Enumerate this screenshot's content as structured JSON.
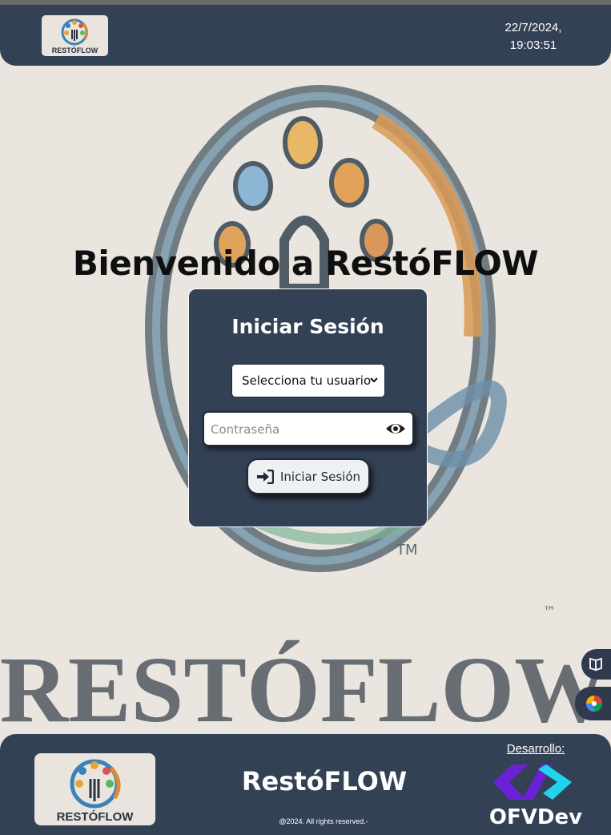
{
  "header": {
    "logo_text": "RESTÓFLOW",
    "date": "22/7/2024,",
    "time": "19:03:51"
  },
  "background": {
    "wordmark": "RESTÓFLOW",
    "tm": "™"
  },
  "main": {
    "welcome_title": "Bienvenido a RestóFLOW"
  },
  "login": {
    "title": "Iniciar Sesión",
    "user_select_value": "Selecciona tu usuario",
    "password_placeholder": "Contraseña",
    "submit_label": "Iniciar Sesión"
  },
  "footer": {
    "logo_text": "RESTÓFLOW",
    "brand": "RestóFLOW",
    "copyright": "@2024. All rights reserved.-",
    "dev_label": "Desarrollo:",
    "dev_name": "OFVDev"
  },
  "icons": {
    "eye": "eye-icon",
    "login": "sign-in-icon",
    "reader": "book-icon",
    "extension": "color-wheel-icon"
  },
  "colors": {
    "header_bg": "#334155",
    "card_bg": "#334155",
    "background": "#eae6df",
    "dev_purple": "#6b21d6",
    "dev_cyan": "#22d3ee"
  }
}
